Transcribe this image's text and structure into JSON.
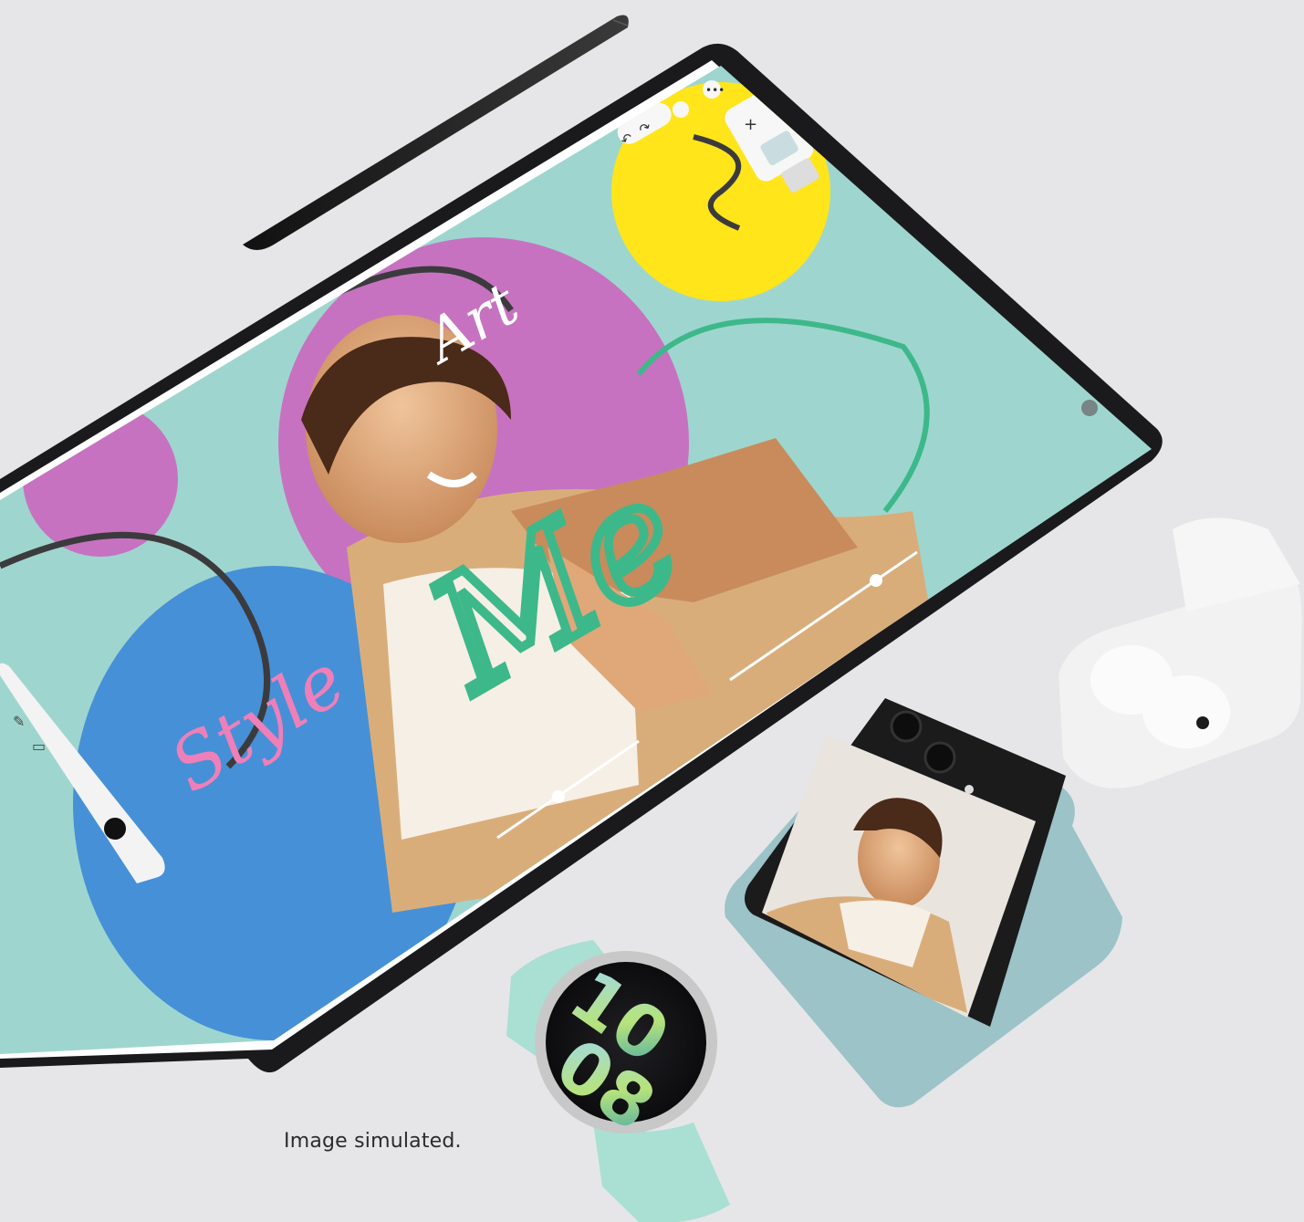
{
  "caption": "Image simulated.",
  "tablet_time_labels": [
    "10:08"
  ],
  "watch_face": {
    "hour": "10",
    "minute": "08"
  },
  "handwriting": {
    "word_1": "Art",
    "word_2": "Style",
    "word_3": "Me"
  },
  "colors": {
    "background": "#e6e6e8",
    "canvas_teal": "#9ed6cf",
    "magenta": "#c772c0",
    "blue": "#4690d8",
    "yellow": "#ffe51a",
    "green_stroke": "#3db88a",
    "pink_stroke": "#ef7fb8",
    "device_black": "#1a1a1c",
    "watch_band": "#a9e0d3",
    "buds_case": "#f4f4f4"
  },
  "icons": [
    "undo-icon",
    "redo-icon",
    "plus-icon",
    "more-icon",
    "pen-icon",
    "eraser-icon",
    "layer-icon"
  ]
}
